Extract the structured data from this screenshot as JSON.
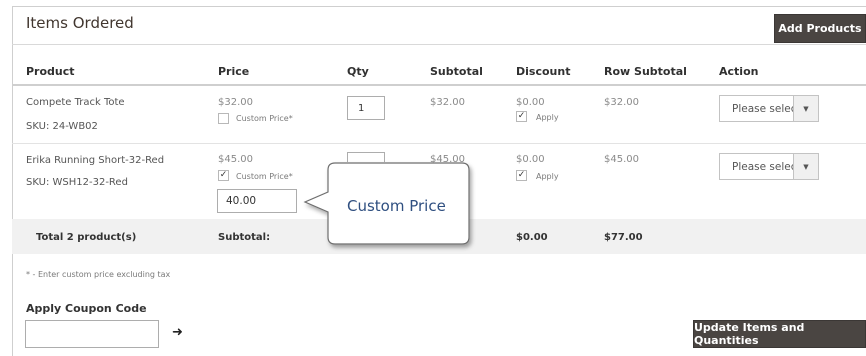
{
  "header": {
    "title": "Items Ordered",
    "add_products_label": "Add Products"
  },
  "columns": [
    "Product",
    "Price",
    "Qty",
    "Subtotal",
    "Discount",
    "Row Subtotal",
    "Action"
  ],
  "rows": [
    {
      "name": "Compete Track Tote",
      "sku": "SKU: 24-WB02",
      "price": "$32.00",
      "custom_price_label": "Custom Price*",
      "custom_price_checked": false,
      "qty": "1",
      "subtotal": "$32.00",
      "discount": "$0.00",
      "apply_label": "Apply",
      "apply_checked": true,
      "row_subtotal": "$32.00",
      "action_value": "Please select"
    },
    {
      "name": "Erika Running Short-32-Red",
      "sku": "SKU: WSH12-32-Red",
      "price": "$45.00",
      "custom_price_label": "Custom Price*",
      "custom_price_checked": true,
      "custom_price_value": "40.00",
      "qty": "",
      "subtotal": "$45.00",
      "discount": "$0.00",
      "apply_label": "Apply",
      "apply_checked": true,
      "row_subtotal": "$45.00",
      "action_value": "Please select"
    }
  ],
  "totals": {
    "label": "Total 2 product(s)",
    "subtotal_label": "Subtotal:",
    "discount": "$0.00",
    "row_subtotal": "$77.00"
  },
  "callout": {
    "text": "Custom Price"
  },
  "footer": {
    "note": "* - Enter custom price excluding tax",
    "coupon_label": "Apply Coupon Code",
    "coupon_value": "",
    "update_label": "Update Items and Quantities"
  },
  "icons": {
    "checkmark": "✓",
    "dropdown": "▼",
    "arrow": "➜"
  },
  "colors": {
    "dark_button": "#4a4542",
    "callout_text": "#2f4f80",
    "totals_background": "#f1f1f1"
  }
}
